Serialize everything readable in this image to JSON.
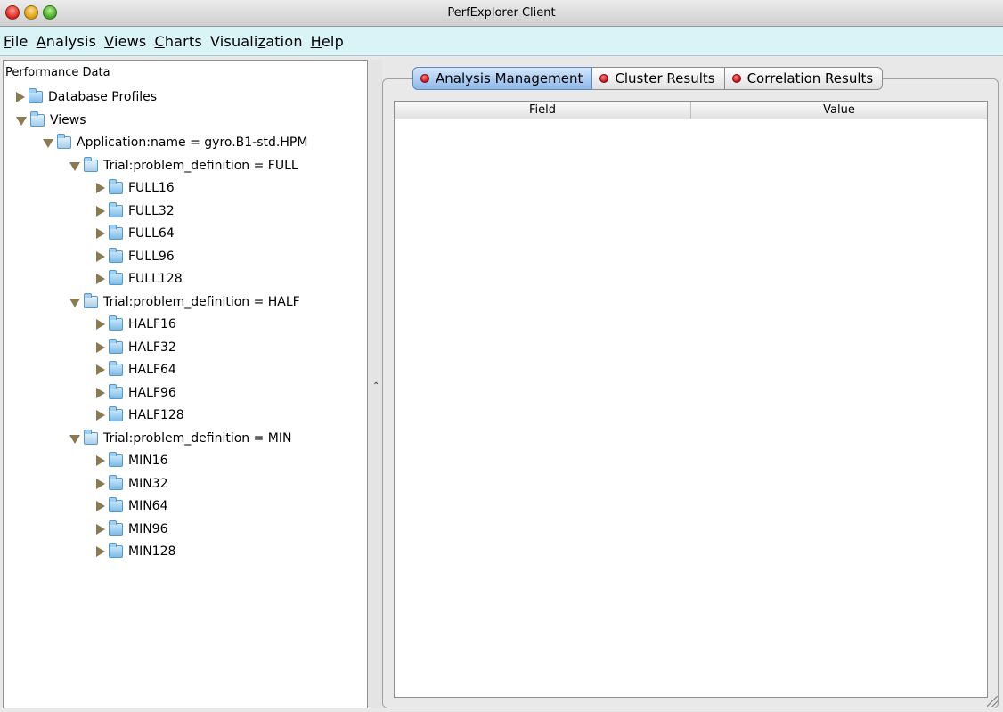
{
  "window": {
    "title": "PerfExplorer Client"
  },
  "menubar": [
    {
      "pre": "",
      "mn": "F",
      "post": "ile"
    },
    {
      "pre": "",
      "mn": "A",
      "post": "nalysis"
    },
    {
      "pre": "",
      "mn": "V",
      "post": "iews"
    },
    {
      "pre": "",
      "mn": "C",
      "post": "harts"
    },
    {
      "pre": "Visuali",
      "mn": "z",
      "post": "ation"
    },
    {
      "pre": "",
      "mn": "H",
      "post": "elp"
    }
  ],
  "tree": {
    "root_label": "Performance Data",
    "nodes": [
      {
        "label": "Database Profiles",
        "expanded": false
      },
      {
        "label": "Views",
        "expanded": true
      },
      {
        "label": "Application:name = gyro.B1-std.HPM",
        "expanded": true
      },
      {
        "label": "Trial:problem_definition = FULL",
        "expanded": true
      },
      {
        "label": "FULL16",
        "expanded": false
      },
      {
        "label": "FULL32",
        "expanded": false
      },
      {
        "label": "FULL64",
        "expanded": false
      },
      {
        "label": "FULL96",
        "expanded": false
      },
      {
        "label": "FULL128",
        "expanded": false
      },
      {
        "label": "Trial:problem_definition = HALF",
        "expanded": true
      },
      {
        "label": "HALF16",
        "expanded": false
      },
      {
        "label": "HALF32",
        "expanded": false
      },
      {
        "label": "HALF64",
        "expanded": false
      },
      {
        "label": "HALF96",
        "expanded": false
      },
      {
        "label": "HALF128",
        "expanded": false
      },
      {
        "label": "Trial:problem_definition = MIN",
        "expanded": true
      },
      {
        "label": "MIN16",
        "expanded": false
      },
      {
        "label": "MIN32",
        "expanded": false
      },
      {
        "label": "MIN64",
        "expanded": false
      },
      {
        "label": "MIN96",
        "expanded": false
      },
      {
        "label": "MIN128",
        "expanded": false
      }
    ]
  },
  "tabs": [
    {
      "label": "Analysis Management",
      "active": true
    },
    {
      "label": "Cluster Results",
      "active": false
    },
    {
      "label": "Correlation Results",
      "active": false
    }
  ],
  "table": {
    "columns": [
      "Field",
      "Value"
    ],
    "rows": []
  },
  "colors": {
    "menubar_bg": "#daf3f6",
    "active_tab": "#8fb8ea",
    "tab_dot": "#c3101a",
    "tree_arrow": "#8a7a52"
  }
}
